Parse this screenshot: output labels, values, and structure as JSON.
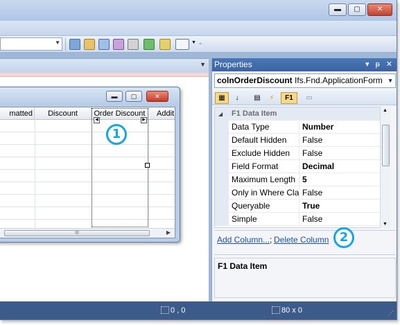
{
  "window": {
    "minimize_glyph": "▬",
    "maximize_glyph": "▢",
    "close_glyph": "✕"
  },
  "designer": {
    "form": {
      "minimize_glyph": "▬",
      "maximize_glyph": "▢",
      "close_glyph": "✕",
      "grid": {
        "columns": [
          "matted",
          "Discount",
          "Order Discount",
          "Addit"
        ],
        "row_count": 8,
        "scroll_thumb": "III",
        "scroll_right": "▶"
      }
    },
    "callout_1": "1"
  },
  "properties": {
    "title": "Properties",
    "header_icons": "▾ ᵽ ✕",
    "object_name": "colnOrderDiscount",
    "object_type": "Ifs.Fnd.ApplicationForm",
    "toolbar": {
      "f1_label": "F1"
    },
    "category": "F1 Data Item",
    "category_toggle": "◢",
    "rows": [
      {
        "name": "Data Type",
        "value": "Number",
        "bold": true
      },
      {
        "name": "Default Hidden",
        "value": "False",
        "bold": false
      },
      {
        "name": "Exclude Hidden",
        "value": "False",
        "bold": false
      },
      {
        "name": "Field Format",
        "value": "Decimal",
        "bold": true
      },
      {
        "name": "Maximum Length",
        "value": "5",
        "bold": true
      },
      {
        "name": "Only in Where Clau",
        "value": "False",
        "bold": false
      },
      {
        "name": "Queryable",
        "value": "True",
        "bold": true
      },
      {
        "name": "Simple",
        "value": "False",
        "bold": false
      }
    ],
    "commands": {
      "add_column": "Add Column...",
      "separator": ";",
      "delete_column": "Delete Column"
    },
    "callout_2": "2",
    "description_title": "F1 Data Item"
  },
  "statusbar": {
    "position": "0 , 0",
    "size": "80 x 0"
  },
  "colors": {
    "accent_callout": "#16a5e0",
    "status_bar": "#3c5a8a",
    "panel_header": "#3f6aa8"
  }
}
